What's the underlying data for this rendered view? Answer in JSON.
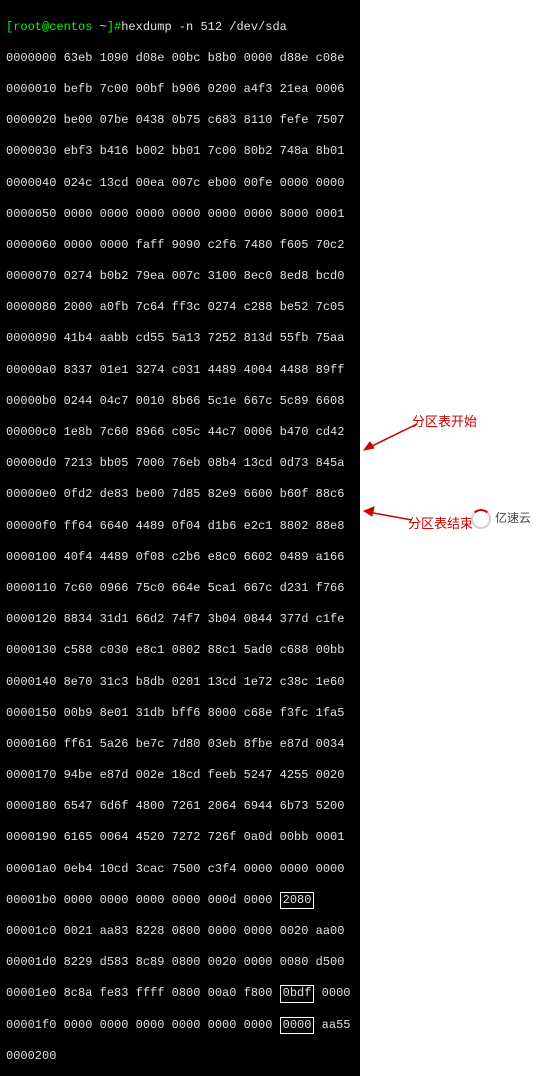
{
  "prompt": {
    "user_host": "[root@centos ",
    "tilde": "~",
    "closing": "]#",
    "command": "hexdump -n 512 /dev/sda"
  },
  "hex": {
    "lines": [
      "0000000 63eb 1090 d08e 00bc b8b0 0000 d88e c08e",
      "0000010 befb 7c00 00bf b906 0200 a4f3 21ea 0006",
      "0000020 be00 07be 0438 0b75 c683 8110 fefe 7507",
      "0000030 ebf3 b416 b002 bb01 7c00 80b2 748a 8b01",
      "0000040 024c 13cd 00ea 007c eb00 00fe 0000 0000",
      "0000050 0000 0000 0000 0000 0000 0000 8000 0001",
      "0000060 0000 0000 faff 9090 c2f6 7480 f605 70c2",
      "0000070 0274 b0b2 79ea 007c 3100 8ec0 8ed8 bcd0",
      "0000080 2000 a0fb 7c64 ff3c 0274 c288 be52 7c05",
      "0000090 41b4 aabb cd55 5a13 7252 813d 55fb 75aa",
      "00000a0 8337 01e1 3274 c031 4489 4004 4488 89ff",
      "00000b0 0244 04c7 0010 8b66 5c1e 667c 5c89 6608",
      "00000c0 1e8b 7c60 8966 c05c 44c7 0006 b470 cd42",
      "00000d0 7213 bb05 7000 76eb 08b4 13cd 0d73 845a",
      "00000e0 0fd2 de83 be00 7d85 82e9 6600 b60f 88c6",
      "00000f0 ff64 6640 4489 0f04 d1b6 e2c1 8802 88e8",
      "0000100 40f4 4489 0f08 c2b6 e8c0 6602 0489 a166",
      "0000110 7c60 0966 75c0 664e 5ca1 667c d231 f766",
      "0000120 8834 31d1 66d2 74f7 3b04 0844 377d c1fe",
      "0000130 c588 c030 e8c1 0802 88c1 5ad0 c688 00bb",
      "0000140 8e70 31c3 b8db 0201 13cd 1e72 c38c 1e60",
      "0000150 00b9 8e01 31db bff6 8000 c68e f3fc 1fa5",
      "0000160 ff61 5a26 be7c 7d80 03eb 8fbe e87d 0034",
      "0000170 94be e87d 002e 18cd feeb 5247 4255 0020",
      "0000180 6547 6d6f 4800 7261 2064 6944 6b73 5200",
      "0000190 6165 0064 4520 7272 726f 0a0d 00bb 0001"
    ],
    "line_1a0_pre": "00001a0 0eb4 10cd 3cac 7500 c3f4 0000 0000 0000",
    "line_1b0_pre": "00001b0 0000 0000 0000 0000 000d 0000 ",
    "line_1b0_box": "2080",
    "line_1c0": "00001c0 0021 aa83 8228 0800 0000 0000 0020 aa00",
    "line_1d0": "00001d0 8229 d583 8c89 0800 0020 0000 0080 d500",
    "line_1e0": "00001e0 8c8a fe83 ffff 0800 00a0 f800 ",
    "line_1e0_box": "0bdf",
    "line_1e0_post": " 0000",
    "line_1f0_pre": "00001f0 0000 0000 0000 0000 0000 0000 ",
    "line_1f0_box": "0000",
    "line_1f0_post": " aa55",
    "line_200": "0000200"
  },
  "annotations": {
    "start": "分区表开始",
    "end": "分区表结束"
  },
  "watermark": "亿速云"
}
